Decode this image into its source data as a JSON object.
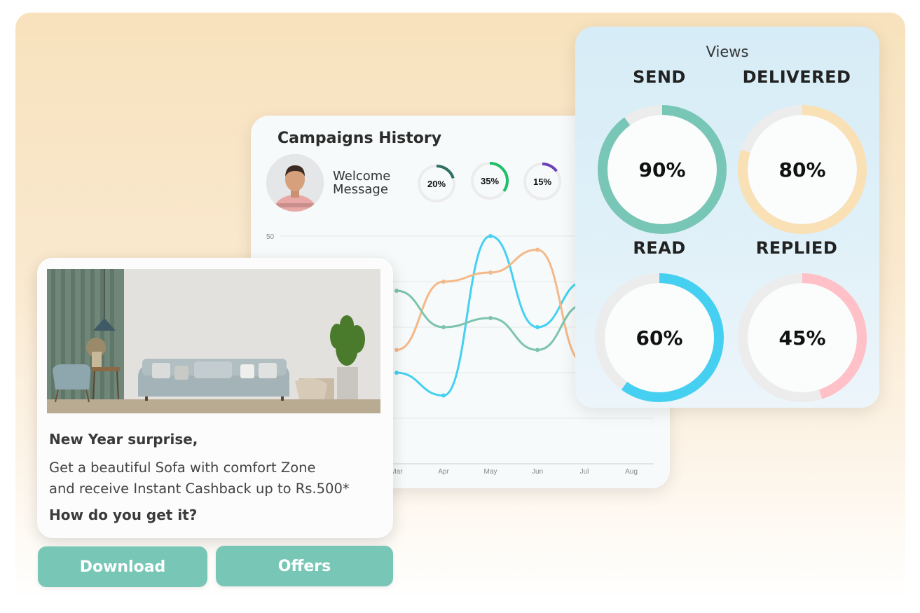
{
  "campaigns": {
    "title": "Campaigns History",
    "welcome": "Welcome\nMessage",
    "mini_stats": [
      {
        "label": "20%",
        "value": 20,
        "color": "#2f6e62"
      },
      {
        "label": "35%",
        "value": 35,
        "color": "#1fbf6a"
      },
      {
        "label": "15%",
        "value": 15,
        "color": "#6a3fb8"
      }
    ]
  },
  "chart_data": {
    "type": "line",
    "categories": [
      "Mar",
      "Apr",
      "May",
      "Jun",
      "Jul",
      "Aug"
    ],
    "ylim": [
      0,
      50
    ],
    "y_ticks": [
      "50"
    ],
    "grid": true,
    "series": [
      {
        "color": "#45d0f2",
        "values": [
          20,
          15,
          50,
          30,
          40,
          null
        ]
      },
      {
        "color": "#f3b98a",
        "values": [
          25,
          40,
          42,
          47,
          22,
          null
        ]
      },
      {
        "color": "#7cc4ac",
        "values": [
          38,
          30,
          32,
          25,
          35,
          null
        ]
      }
    ]
  },
  "views": {
    "title": "Views",
    "stats": [
      {
        "label": "SEND",
        "value_text": "90%",
        "value": 90,
        "color": "#78c6b5"
      },
      {
        "label": "DELIVERED",
        "value_text": "80%",
        "value": 80,
        "color": "#f9e0b5"
      },
      {
        "label": "READ",
        "value_text": "60%",
        "value": 60,
        "color": "#45d0f2"
      },
      {
        "label": "REPLIED",
        "value_text": "45%",
        "value": 45,
        "color": "#ffc0c8"
      }
    ]
  },
  "offer": {
    "heading": "New Year surprise,",
    "body": "Get a beautiful Sofa with comfort Zone\nand receive Instant Cashback up to Rs.500*",
    "question": "How do you get it?"
  },
  "buttons": {
    "download": "Download",
    "offers": "Offers"
  }
}
